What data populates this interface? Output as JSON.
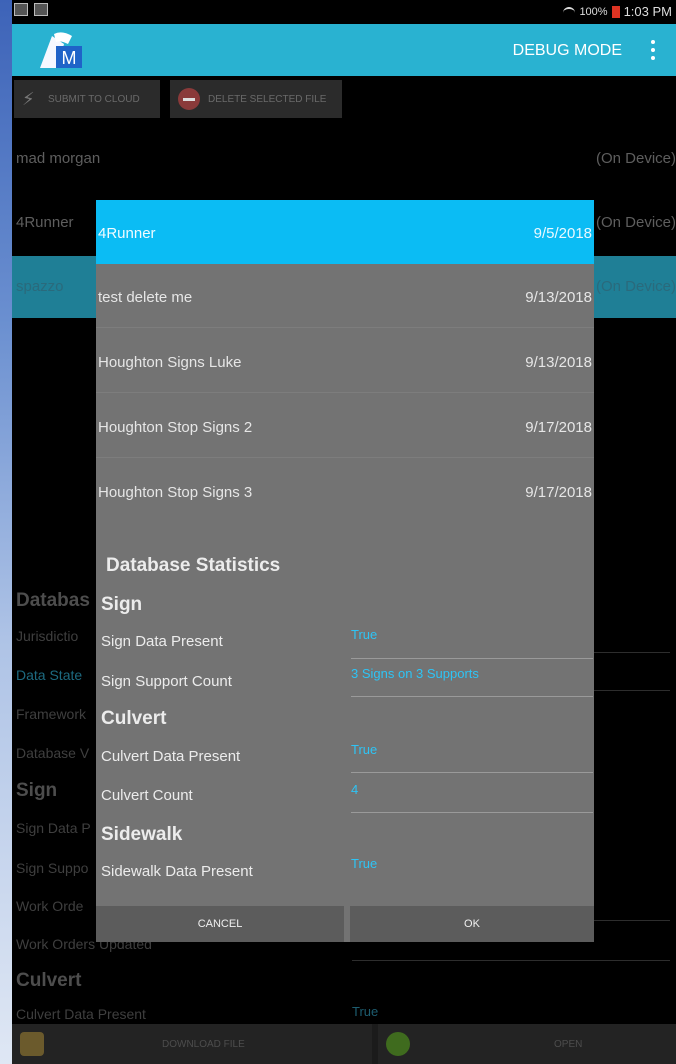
{
  "statusbar": {
    "battery": "100%",
    "time": "1:03 PM"
  },
  "appbar": {
    "debug_label": "DEBUG MODE",
    "logo_text": "M"
  },
  "background": {
    "buttons": {
      "submit": "SUBMIT TO CLOUD",
      "delete": "DELETE SELECTED FILE"
    },
    "files": [
      {
        "name": "mad morgan",
        "status": "(On Device)"
      },
      {
        "name": "4Runner",
        "status": "(On Device)"
      },
      {
        "name": "spazzo",
        "status": "(On Device)"
      }
    ],
    "stats": {
      "heading": "Databas",
      "labels": [
        "Jurisdictio",
        "Data State",
        "Framework",
        "Database V"
      ],
      "sign_heading": "Sign",
      "sign_labels": [
        "Sign Data P",
        "Sign Suppo",
        "Work Orde",
        "Work Orders Updated"
      ],
      "culvert_heading": "Culvert",
      "culvert_label": "Culvert Data Present",
      "culvert_value": "True"
    },
    "bottom": {
      "download": "DOWNLOAD FILE",
      "open": "OPEN"
    }
  },
  "dialog": {
    "files": [
      {
        "name": "4Runner",
        "date": "9/5/2018"
      },
      {
        "name": "test delete me",
        "date": "9/13/2018"
      },
      {
        "name": "Houghton Signs Luke",
        "date": "9/13/2018"
      },
      {
        "name": "Houghton Stop Signs 2",
        "date": "9/17/2018"
      },
      {
        "name": "Houghton Stop Signs 3",
        "date": "9/17/2018"
      }
    ],
    "stats_title": "Database Statistics",
    "sign": {
      "heading": "Sign",
      "data_present_label": "Sign Data Present",
      "data_present_value": "True",
      "support_count_label": "Sign Support Count",
      "support_count_value": "3 Signs on 3 Supports"
    },
    "culvert": {
      "heading": "Culvert",
      "data_present_label": "Culvert Data Present",
      "data_present_value": "True",
      "count_label": "Culvert Count",
      "count_value": "4"
    },
    "sidewalk": {
      "heading": "Sidewalk",
      "data_present_label": "Sidewalk Data Present",
      "data_present_value": "True"
    },
    "cancel_label": "CANCEL",
    "ok_label": "OK"
  }
}
